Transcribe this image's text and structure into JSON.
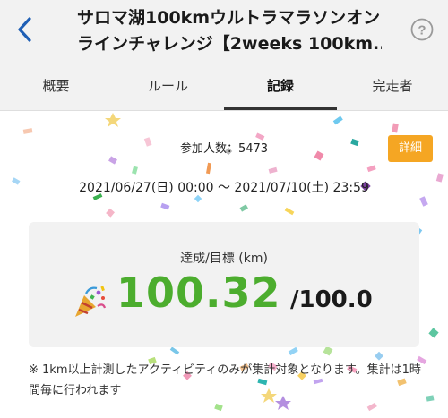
{
  "header": {
    "title_line1": "サロマ湖100kmウルトラマラソンオン",
    "title_line2": "ラインチャレンジ【2weeks 100km..."
  },
  "tabs": [
    {
      "label": "概要",
      "active": false
    },
    {
      "label": "ルール",
      "active": false
    },
    {
      "label": "記録",
      "active": true
    },
    {
      "label": "完走者",
      "active": false
    }
  ],
  "participants": {
    "label": "参加人数：",
    "value": "5473"
  },
  "detail_button": "詳細",
  "period": "2021/06/27(日) 00:00 〜 2021/07/10(土) 23:59",
  "progress": {
    "label": "達成/目標 (km)",
    "achieved": "100.32",
    "goal": "/100.0"
  },
  "note": "※ 1km以上計測したアクティビティのみが集計対象となります。集計は1時間毎に行われます",
  "colors": {
    "accent_green": "#4cad2e",
    "button_orange": "#f5a623",
    "back_blue": "#1f5fb5"
  }
}
